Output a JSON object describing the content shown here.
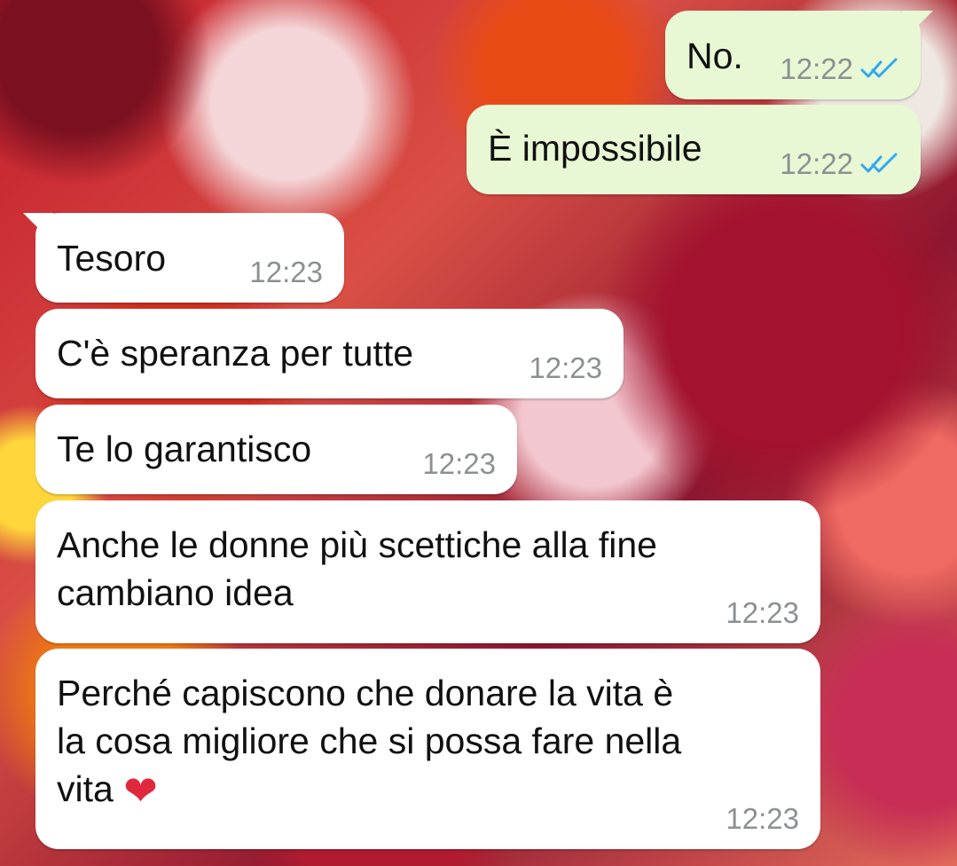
{
  "chat": {
    "messages": [
      {
        "direction": "outgoing",
        "text": "No.",
        "time": "12:22",
        "status": "read"
      },
      {
        "direction": "outgoing",
        "text": "È impossibile",
        "time": "12:22",
        "status": "read"
      },
      {
        "direction": "incoming",
        "text": "Tesoro",
        "time": "12:23"
      },
      {
        "direction": "incoming",
        "text": "C'è speranza per tutte",
        "time": "12:23"
      },
      {
        "direction": "incoming",
        "text": "Te lo garantisco",
        "time": "12:23"
      },
      {
        "direction": "incoming",
        "text": "Anche le donne più scettiche alla fine\ncambiano idea",
        "time": "12:23"
      },
      {
        "direction": "incoming",
        "text": "Perché capiscono che donare la vita è\nla cosa migliore che si possa fare nella\nvita",
        "emoji": "❤",
        "time": "12:23"
      }
    ]
  },
  "colors": {
    "outgoing_bubble": "#e8f8d4",
    "incoming_bubble": "#ffffff",
    "read_ticks": "#31a8ef",
    "timestamp": "#8d9092"
  },
  "icons": {
    "read_receipt": "double-check-icon",
    "emoji": "red-heart-emoji"
  }
}
